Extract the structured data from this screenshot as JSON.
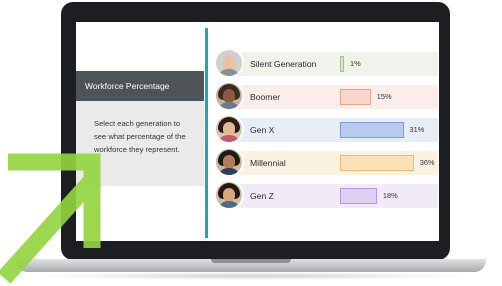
{
  "sidebar": {
    "title": "Workforce Percentage",
    "description": "Select each generation to see what percentage of the workforce they represent."
  },
  "colors": {
    "divider": "#23a3b5",
    "arrow": "#93d53e",
    "header_bg": "#4e5357"
  },
  "chart_data": {
    "type": "bar",
    "categories": [
      "Silent Generation",
      "Boomer",
      "Gen X",
      "Millennial",
      "Gen Z"
    ],
    "values": [
      1,
      15,
      31,
      36,
      18
    ],
    "value_labels": [
      "1%",
      "15%",
      "31%",
      "36%",
      "18%"
    ],
    "unit": "%",
    "title": "",
    "xlabel": "",
    "ylabel": "",
    "colors": {
      "row_backgrounds": [
        "#eff3ea",
        "#fbeeea",
        "#e7edf7",
        "#fbf1e0",
        "#f1ebf8"
      ],
      "bar_fills": [
        "#dbe7cf",
        "#f8d6ca",
        "#b9cbec",
        "#fae1b6",
        "#e0cff5"
      ],
      "bar_borders": [
        "#a4bd8b",
        "#e6a58e",
        "#7f9ed6",
        "#e4bf6f",
        "#b59ae0"
      ]
    }
  }
}
